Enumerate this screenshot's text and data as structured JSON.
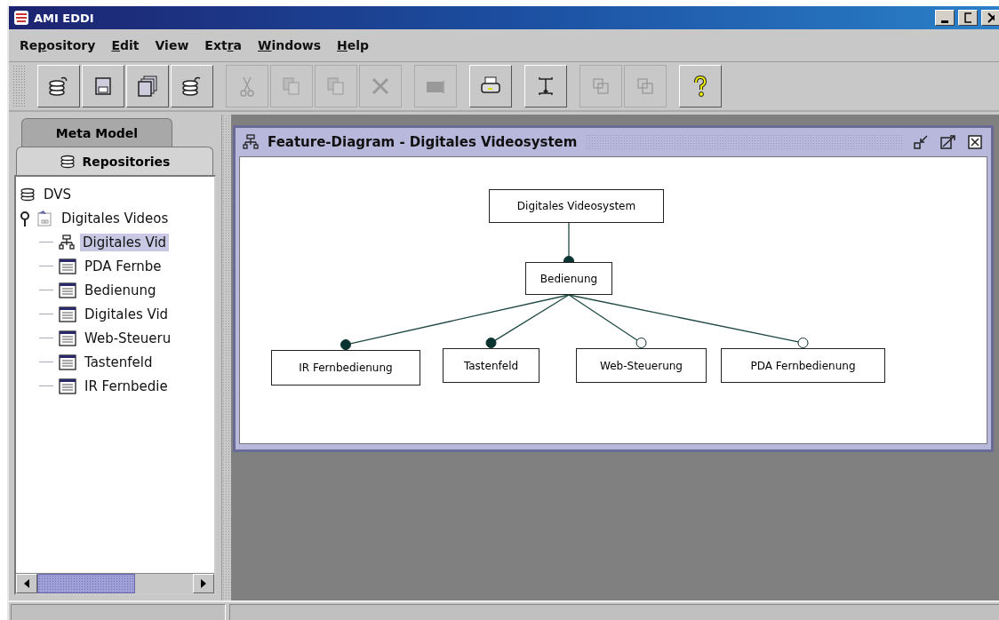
{
  "window": {
    "title": "AMI EDDI"
  },
  "menu": [
    {
      "label_start": "Re",
      "mnemonic": "p",
      "label_end": "ository"
    },
    {
      "mnemonic": "E",
      "label_end": "dit"
    },
    {
      "label_start": "View"
    },
    {
      "label_start": "Ext",
      "mnemonic": "r",
      "label_end": "a"
    },
    {
      "mnemonic": "W",
      "label_end": "indows"
    },
    {
      "mnemonic": "H",
      "label_end": "elp"
    }
  ],
  "toolbar": [
    [
      {
        "kind": "db-load",
        "disabled": false
      },
      {
        "kind": "save",
        "disabled": false
      },
      {
        "kind": "save-all",
        "disabled": false
      },
      {
        "kind": "db-reload",
        "disabled": false
      }
    ],
    [
      {
        "kind": "cut",
        "disabled": true
      },
      {
        "kind": "copy",
        "disabled": true
      },
      {
        "kind": "paste",
        "disabled": true
      },
      {
        "kind": "delete",
        "disabled": true
      }
    ],
    [
      {
        "kind": "rename",
        "disabled": true
      }
    ],
    [
      {
        "kind": "print",
        "disabled": false
      }
    ],
    [
      {
        "kind": "align",
        "disabled": false
      }
    ],
    [
      {
        "kind": "layout",
        "disabled": true
      },
      {
        "kind": "layout",
        "disabled": true
      }
    ],
    [
      {
        "kind": "help",
        "disabled": false
      }
    ]
  ],
  "side_tabs": [
    {
      "label": "Meta Model",
      "selected": false
    },
    {
      "label": "Repositories",
      "selected": true
    }
  ],
  "tree": [
    {
      "label": "DVS",
      "kind": "repository",
      "selected": false,
      "children": [
        {
          "label": "Digitales Videos",
          "kind": "model",
          "expanded": true,
          "selected": false,
          "children": [
            {
              "label": "Digitales Vid",
              "kind": "diagram",
              "selected": true
            },
            {
              "label": "PDA Fernbe",
              "kind": "feature",
              "selected": false
            },
            {
              "label": "Bedienung",
              "kind": "feature",
              "selected": false
            },
            {
              "label": "Digitales Vid",
              "kind": "feature",
              "selected": false
            },
            {
              "label": "Web-Steueru",
              "kind": "feature",
              "selected": false
            },
            {
              "label": "Tastenfeld",
              "kind": "feature",
              "selected": false
            },
            {
              "label": "IR Fernbedie",
              "kind": "feature",
              "selected": false
            }
          ]
        }
      ]
    }
  ],
  "frame": {
    "title": "Feature-Diagram - Digitales Videosystem",
    "diagram": {
      "label": "Digitales Videosystem",
      "children": [
        {
          "label": "Bedienung",
          "mandatory": true,
          "children": [
            {
              "label": "IR Fernbedienung",
              "mandatory": true
            },
            {
              "label": "Tastenfeld",
              "mandatory": true
            },
            {
              "label": "Web-Steuerung",
              "mandatory": false
            },
            {
              "label": "PDA Fernbedienung",
              "mandatory": false
            }
          ]
        }
      ]
    }
  }
}
